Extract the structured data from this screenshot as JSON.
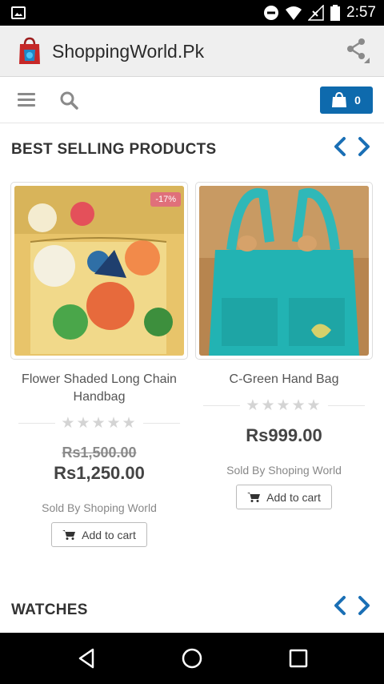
{
  "status_bar": {
    "time": "2:57",
    "icons": [
      "image-icon",
      "dnd-icon",
      "wifi-icon",
      "no-signal-icon",
      "battery-icon"
    ]
  },
  "app_bar": {
    "title": "ShoppingWorld.Pk",
    "share_icon": "share-icon"
  },
  "toolbar": {
    "menu_icon": "menu-icon",
    "search_icon": "search-icon",
    "cart_count": "0",
    "accent": "#0e6aad"
  },
  "sections": {
    "best_selling": {
      "title": "BEST SELLING PRODUCTS",
      "products": [
        {
          "name": "Flower Shaded Long Chain Handbag",
          "badge": "-17%",
          "old_price": "Rs1,500.00",
          "price": "Rs1,250.00",
          "seller": "Sold By Shoping World",
          "add_to_cart": "Add to cart",
          "rating": 0
        },
        {
          "name": "C-Green Hand Bag",
          "price": "Rs999.00",
          "seller": "Sold By Shoping World",
          "add_to_cart": "Add to cart",
          "rating": 0
        }
      ]
    },
    "watches": {
      "title": "WATCHES"
    }
  },
  "colors": {
    "arrow": "#1a6fb5",
    "badge": "#e0707a"
  }
}
